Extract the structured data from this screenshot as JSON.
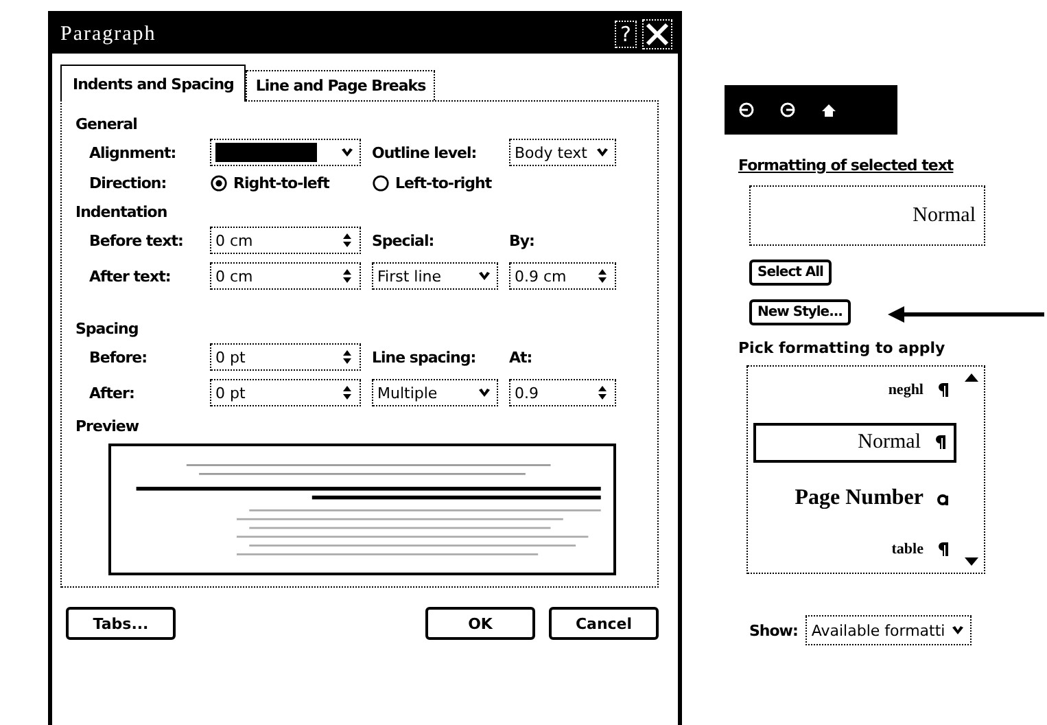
{
  "dialog": {
    "title": "Paragraph",
    "help": "?",
    "tabs": [
      {
        "label": "Indents and Spacing",
        "selected": true
      },
      {
        "label": "Line and Page Breaks",
        "selected": false
      }
    ],
    "general": {
      "heading": "General",
      "alignment_label": "Alignment:",
      "direction_label": "Direction:",
      "directions": [
        {
          "label": "Right-to-left",
          "selected": true
        },
        {
          "label": "Left-to-right",
          "selected": false
        }
      ],
      "outline_label": "Outline level:",
      "outline_value": "Body text"
    },
    "indentation": {
      "heading": "Indentation",
      "before_label": "Before text:",
      "before_value": "0 cm",
      "after_label": "After text:",
      "after_value": "0 cm",
      "special_label": "Special:",
      "special_value": "First line",
      "by_label": "By:",
      "by_value": "0.9 cm"
    },
    "spacing": {
      "heading": "Spacing",
      "before_label": "Before:",
      "before_value": "0 pt",
      "after_label": "After:",
      "after_value": "0 pt",
      "line_label": "Line spacing:",
      "line_value": "Multiple",
      "at_label": "At:",
      "at_value": "0.9"
    },
    "preview": {
      "heading": "Preview"
    },
    "buttons": [
      "Tabs...",
      "OK",
      "Cancel"
    ]
  },
  "task_pane": {
    "formatting_heading": "Formatting of selected text",
    "current_style": "Normal",
    "buttons": [
      "Select All",
      "New Style..."
    ],
    "pick_heading": "Pick formatting to apply",
    "styles": [
      {
        "name": "neghl",
        "kind": "paragraph",
        "selected": false
      },
      {
        "name": "Normal",
        "kind": "paragraph",
        "selected": true
      },
      {
        "name": "Page Number",
        "kind": "character",
        "selected": false
      },
      {
        "name": "table",
        "kind": "paragraph",
        "selected": false
      }
    ],
    "show_label": "Show:",
    "show_value": "Available formatti"
  }
}
